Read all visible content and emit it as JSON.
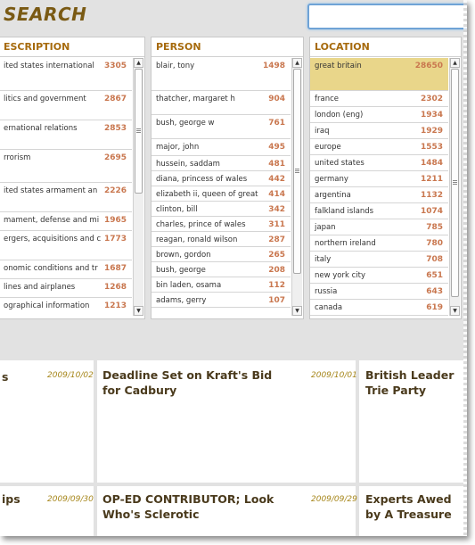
{
  "search": {
    "title": "SEARCH",
    "value": "",
    "placeholder": ""
  },
  "facets": {
    "description": {
      "header": "ESCRIPTION",
      "items": [
        {
          "label": "ited states international",
          "count": "3305"
        },
        {
          "label": "litics and government",
          "count": "2867"
        },
        {
          "label": "ernational relations",
          "count": "2853"
        },
        {
          "label": "rrorism",
          "count": "2695"
        },
        {
          "label": "ited states armament an",
          "count": "2226"
        },
        {
          "label": "mament, defense and mi",
          "count": "1965"
        },
        {
          "label": "ergers, acquisitions and c",
          "count": "1773"
        },
        {
          "label": "onomic conditions and tr",
          "count": "1687"
        },
        {
          "label": "lines and airplanes",
          "count": "1268"
        },
        {
          "label": "ographical information",
          "count": "1213"
        }
      ]
    },
    "person": {
      "header": "PERSON",
      "items": [
        {
          "label": "blair, tony",
          "count": "1498"
        },
        {
          "label": "thatcher, margaret h",
          "count": "904"
        },
        {
          "label": "bush, george w",
          "count": "761"
        },
        {
          "label": "major, john",
          "count": "495"
        },
        {
          "label": "hussein, saddam",
          "count": "481"
        },
        {
          "label": "diana, princess of wales",
          "count": "442"
        },
        {
          "label": "elizabeth ii, queen of great",
          "count": "414"
        },
        {
          "label": "clinton, bill",
          "count": "342"
        },
        {
          "label": "charles, prince of wales",
          "count": "311"
        },
        {
          "label": "reagan, ronald wilson",
          "count": "287"
        },
        {
          "label": "brown, gordon",
          "count": "265"
        },
        {
          "label": "bush, george",
          "count": "208"
        },
        {
          "label": "bin laden, osama",
          "count": "112"
        },
        {
          "label": "adams, gerry",
          "count": "107"
        }
      ]
    },
    "location": {
      "header": "LOCATION",
      "items": [
        {
          "label": "great britain",
          "count": "28650",
          "selected": true
        },
        {
          "label": "france",
          "count": "2302"
        },
        {
          "label": "london (eng)",
          "count": "1934"
        },
        {
          "label": "iraq",
          "count": "1929"
        },
        {
          "label": "europe",
          "count": "1553"
        },
        {
          "label": "united states",
          "count": "1484"
        },
        {
          "label": "germany",
          "count": "1211"
        },
        {
          "label": "argentina",
          "count": "1132"
        },
        {
          "label": "falkland islands",
          "count": "1074"
        },
        {
          "label": "japan",
          "count": "785"
        },
        {
          "label": "northern ireland",
          "count": "780"
        },
        {
          "label": "italy",
          "count": "708"
        },
        {
          "label": "new york city",
          "count": "651"
        },
        {
          "label": "russia",
          "count": "643"
        },
        {
          "label": "canada",
          "count": "619"
        }
      ]
    }
  },
  "results": [
    {
      "headline": "s",
      "date": "2009/10/02"
    },
    {
      "headline": "Deadline Set on Kraft's Bid for Cadbury",
      "date": "2009/10/01"
    },
    {
      "headline": "British Leader Trie Party",
      "date": ""
    },
    {
      "headline": "ips",
      "date": "2009/09/30"
    },
    {
      "headline": "OP-ED CONTRIBUTOR; Look Who's Sclerotic",
      "date": "2009/09/29"
    },
    {
      "headline": "Experts Awed by A Treasure",
      "date": ""
    }
  ],
  "scroll_icons": {
    "up": "arrow-up-icon",
    "down": "arrow-down-icon"
  },
  "colors": {
    "accent": "#a66a0c",
    "count": "#c9774f",
    "selected": "#e9d68a",
    "date": "#a6861a"
  }
}
